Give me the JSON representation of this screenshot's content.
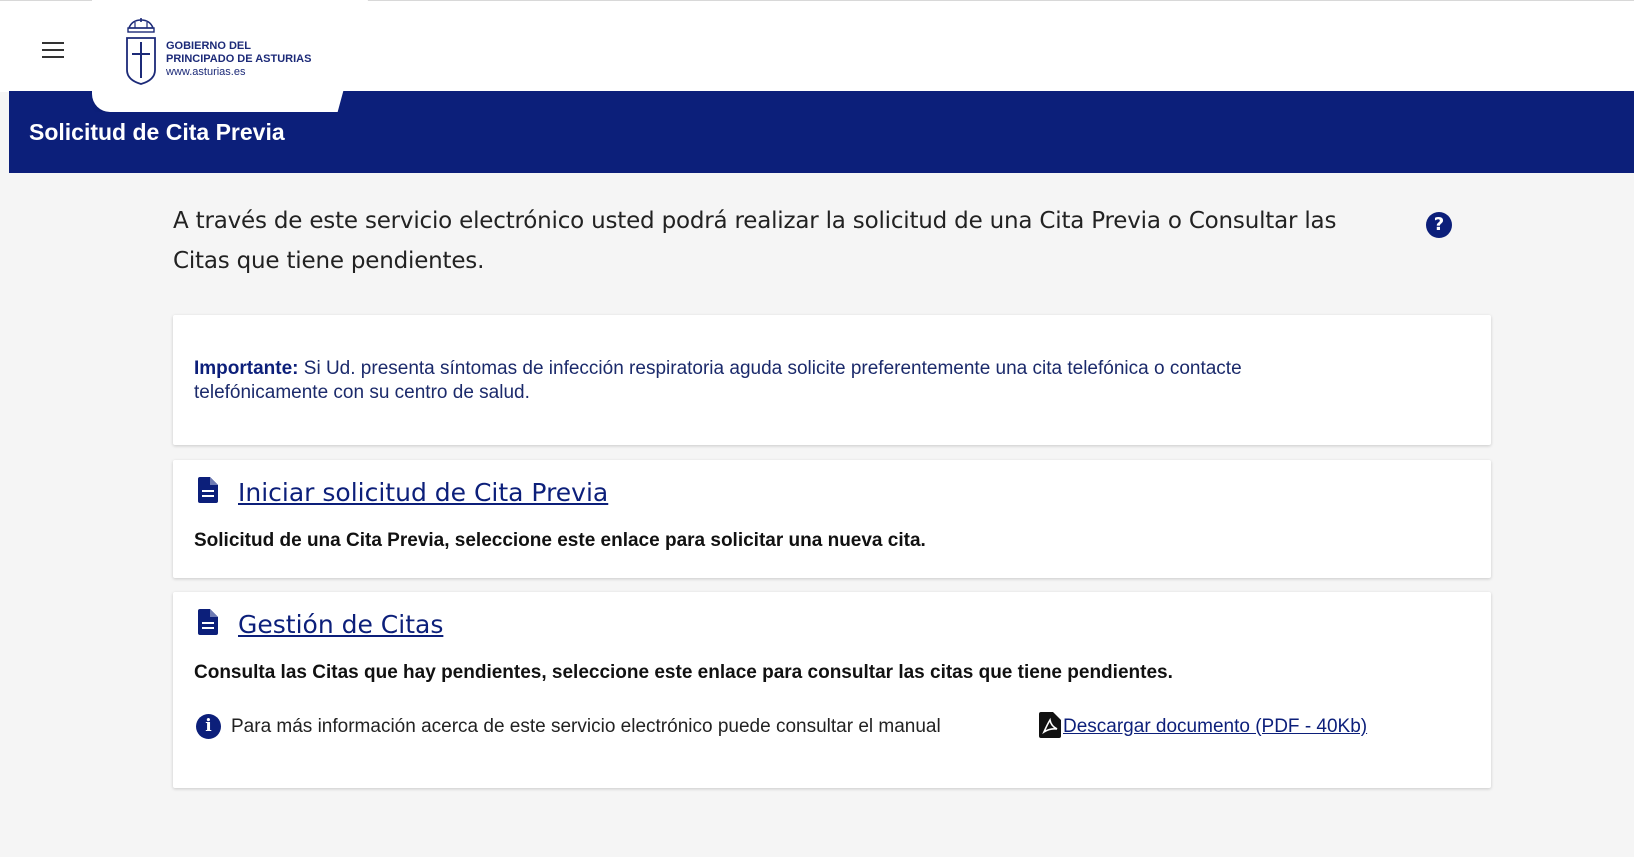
{
  "header": {
    "menu_icon": "hamburger-menu-icon",
    "logo": {
      "line1": "GOBIERNO DEL",
      "line2": "PRINCIPADO DE ASTURIAS",
      "url": "www.asturias.es"
    },
    "title": "Solicitud de Cita Previa"
  },
  "intro": {
    "text": "A través de este servicio electrónico usted podrá realizar la solicitud de una Cita Previa o Consultar las Citas que tiene pendientes.",
    "help_icon": "question-circle-icon"
  },
  "important": {
    "label": "Importante:",
    "text": " Si Ud. presenta síntomas de infección respiratoria aguda solicite preferentemente una cita telefónica o contacte telefónicamente con su centro de salud."
  },
  "cards": [
    {
      "icon": "document-icon",
      "link": "Iniciar solicitud de Cita Previa",
      "description": "Solicitud de una Cita Previa, seleccione este enlace para solicitar una nueva cita."
    },
    {
      "icon": "document-icon",
      "link": "Gestión de Citas",
      "description": "Consulta las Citas que hay pendientes, seleccione este enlace para consultar las citas que tiene pendientes."
    }
  ],
  "manual": {
    "info_icon": "info-circle-icon",
    "text": "Para más información acerca de este servicio electrónico puede consultar el manual",
    "pdf_icon": "pdf-file-icon",
    "download_link": " Descargar documento (PDF - 40Kb)"
  },
  "colors": {
    "brand_blue": "#0c1f7a",
    "background": "#f5f5f5",
    "card": "#ffffff"
  }
}
